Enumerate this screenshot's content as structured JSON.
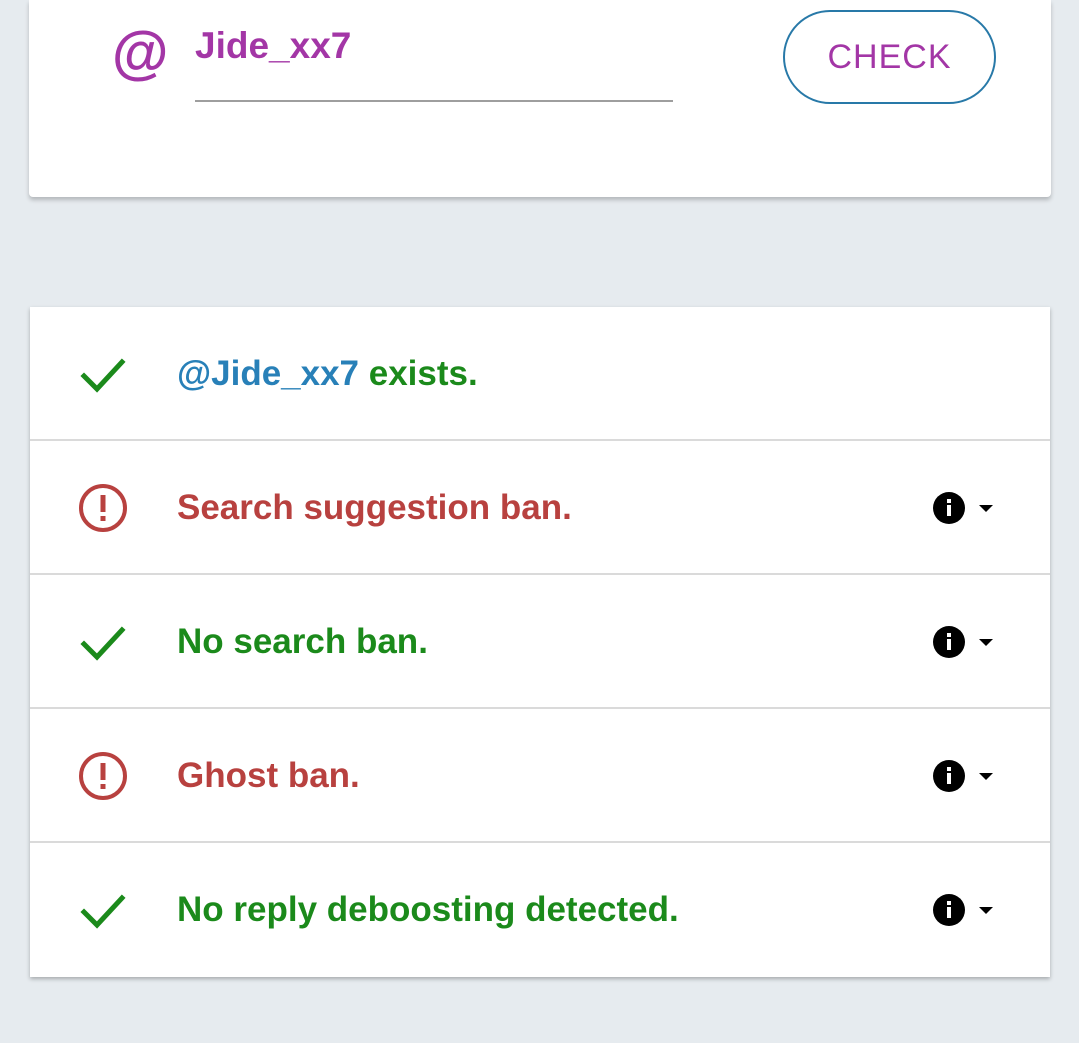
{
  "search": {
    "at_symbol": "@",
    "username_value": "Jide_xx7",
    "check_label": "CHECK"
  },
  "results": [
    {
      "status": "ok",
      "icon": "checkmark-icon",
      "handle": "@Jide_xx7",
      "text": " exists.",
      "has_actions": false
    },
    {
      "status": "bad",
      "icon": "alert-circle-icon",
      "handle": "",
      "text": "Search suggestion ban.",
      "has_actions": true
    },
    {
      "status": "ok",
      "icon": "checkmark-icon",
      "handle": "",
      "text": "No search ban.",
      "has_actions": true
    },
    {
      "status": "bad",
      "icon": "alert-circle-icon",
      "handle": "",
      "text": "Ghost ban.",
      "has_actions": true
    },
    {
      "status": "ok",
      "icon": "checkmark-icon",
      "handle": "",
      "text": "No reply deboosting detected.",
      "has_actions": true
    }
  ],
  "colors": {
    "accent_purple": "#a336a6",
    "ok_green": "#1b8a1b",
    "bad_red": "#b8413f",
    "link_blue": "#2880b8",
    "button_border": "#2879a8",
    "background": "#e6ebef"
  }
}
